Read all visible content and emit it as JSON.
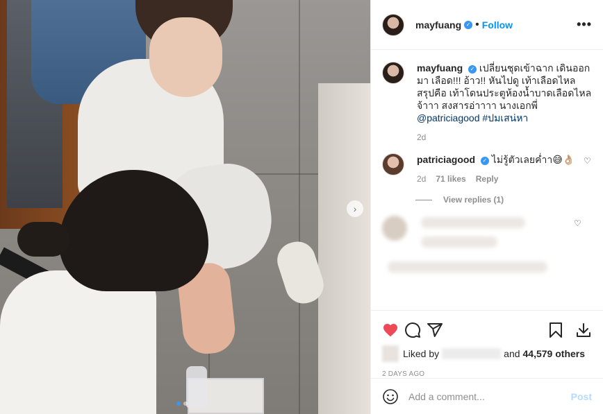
{
  "post": {
    "username": "mayfuang",
    "verified": true,
    "follow_label": "Follow",
    "separator": "•",
    "more_label": "•••",
    "carousel_next": "›",
    "media_slides": 2,
    "media_active_slide": 1
  },
  "caption": {
    "username": "mayfuang",
    "text": "เปลี่ยนชุดเข้าฉาก เดินออกมา เลือด!!! อ้าว!! หันไปดู เท้าเลือดไหล สรุปคือ เท้าโดนประตูห้องน้ำบาดเลือดไหล จ้าาา สงสารอ่าาาา นางเอกพี่",
    "mention": "@patriciagood",
    "hashtag": "#ปมเสน่หา",
    "time": "2d"
  },
  "comments": [
    {
      "username": "patriciagood",
      "verified": true,
      "text": "ไม่รู้ตัวเลยค่ำา😅👌🏼",
      "time": "2d",
      "likes": "71 likes",
      "reply_label": "Reply",
      "view_replies": "View replies (1)"
    }
  ],
  "actions": {
    "like_icon": "heart-filled-icon",
    "comment_icon": "comment-icon",
    "share_icon": "share-icon",
    "save_icon": "bookmark-icon",
    "download_icon": "download-icon",
    "like_color": "#ed4956"
  },
  "likes": {
    "prefix": "Liked by",
    "and_label": "and",
    "others": "44,579 others"
  },
  "date": "2 DAYS AGO",
  "add_comment": {
    "placeholder": "Add a comment...",
    "post_label": "Post",
    "emoji_icon": "emoji-icon"
  }
}
